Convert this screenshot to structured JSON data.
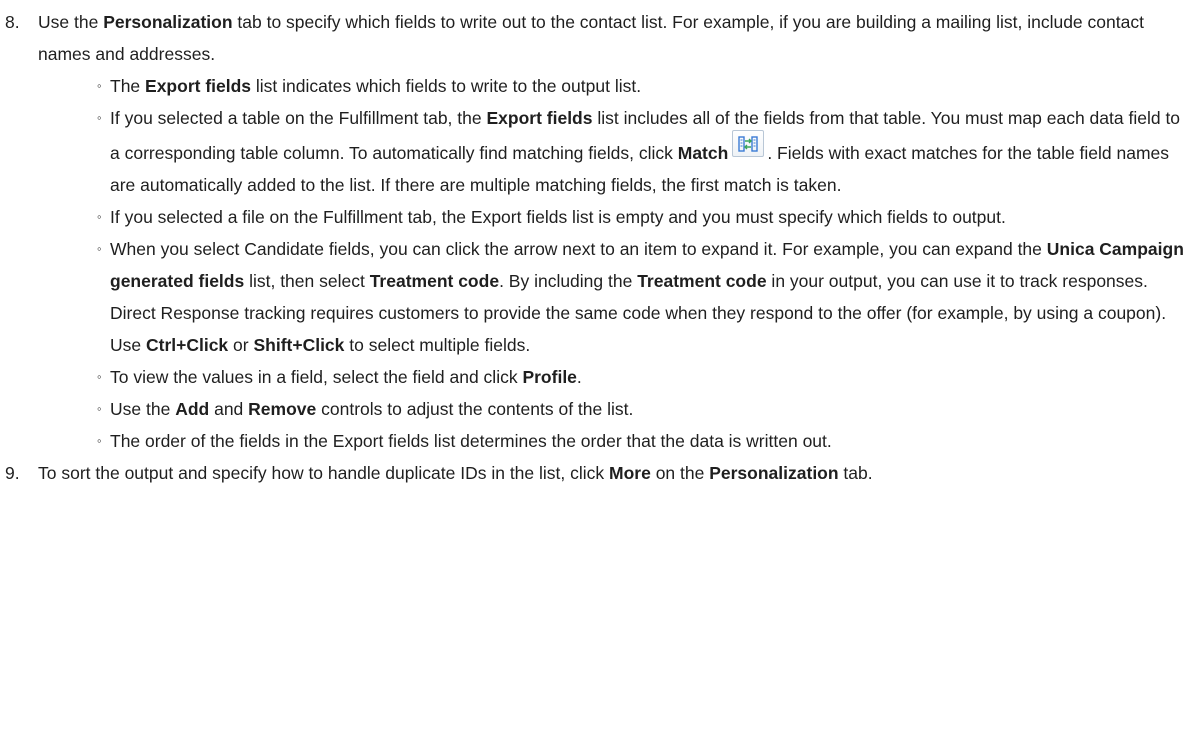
{
  "step8": {
    "number": "8.",
    "t1": "Use the ",
    "b1": "Personalization",
    "t2": " tab to specify which fields to write out to the contact list. For example, if you are building a mailing list, include contact names and addresses."
  },
  "bullet_glyph": "◦",
  "bullets": {
    "b1": {
      "t1": "The ",
      "b1": "Export fields",
      "t2": " list indicates which fields to write to the output list."
    },
    "b2": {
      "t1": "If you selected a table on the Fulfillment tab, the ",
      "b1": "Export fields",
      "t2": " list includes all of the fields from that table. You must map each data field to a corresponding table column. To automatically find matching fields, click ",
      "b2": "Match",
      "icon": "match-fields-icon",
      "t3": ". Fields with exact matches for the table field names are automatically added to the list. If there are multiple matching fields, the first match is taken."
    },
    "b3": {
      "t1": "If you selected a file on the Fulfillment tab, the Export fields list is empty and you must specify which fields to output."
    },
    "b4": {
      "t1": "When you select Candidate fields, you can click the arrow next to an item to expand it. For example, you can expand the ",
      "b1": "Unica Campaign generated fields",
      "t2": " list, then select ",
      "b2": "Treatment code",
      "t3": ". By including the ",
      "b3": "Treatment code",
      "t4": " in your output, you can use it to track responses. Direct Response tracking requires customers to provide the same code when they respond to the offer (for example, by using a coupon). Use ",
      "b4": "Ctrl+Click",
      "t5": " or ",
      "b5": "Shift+Click",
      "t6": " to select multiple fields."
    },
    "b5": {
      "t1": "To view the values in a field, select the field and click ",
      "b1": "Profile",
      "t2": "."
    },
    "b6": {
      "t1": "Use the ",
      "b1": "Add",
      "t2": " and ",
      "b2": "Remove",
      "t3": " controls to adjust the contents of the list."
    },
    "b7": {
      "t1": "The order of the fields in the Export fields list determines the order that the data is written out."
    }
  },
  "step9": {
    "number": "9.",
    "t1": "To sort the output and specify how to handle duplicate IDs in the list, click ",
    "b1": "More",
    "t2": " on the ",
    "b2": "Personalization",
    "t3": " tab."
  },
  "colors": {
    "text": "#1f1f1f",
    "icon_blue": "#3a7bd5",
    "icon_green": "#3aa55a"
  }
}
